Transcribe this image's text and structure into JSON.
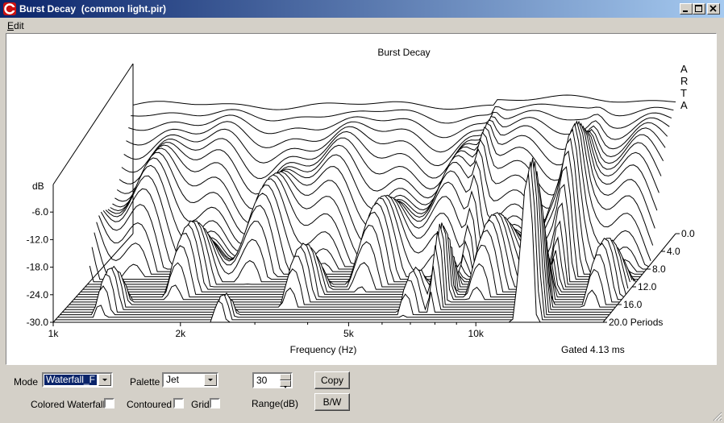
{
  "window": {
    "title": "Burst Decay  (common light.pir)",
    "controls": [
      "minimize-icon",
      "maximize-icon",
      "close-icon"
    ]
  },
  "menu": {
    "edit_accel": "E",
    "edit_rest": "dit"
  },
  "plot": {
    "title": "Burst Decay",
    "ylabel": "dB",
    "xlabel": "Frequency (Hz)",
    "gated_label": "Gated 4.13 ms",
    "arta_letters": [
      "A",
      "R",
      "T",
      "A"
    ],
    "y_ticks": [
      "-6.0",
      "-12.0",
      "-18.0",
      "-24.0",
      "-30.0"
    ],
    "x_ticks": [
      "1k",
      "2k",
      "5k",
      "10k"
    ],
    "z_ticks": [
      "0.0",
      "4.0",
      "8.0",
      "12.0",
      "16.0",
      "20.0 Periods"
    ]
  },
  "chart_data": {
    "type": "waterfall",
    "title": "Burst Decay",
    "xlabel": "Frequency (Hz)",
    "ylabel": "dB",
    "zlabel": "Periods",
    "x_scale": "log",
    "xlim": [
      1000,
      20000
    ],
    "ylim": [
      -30,
      0
    ],
    "zlim": [
      0,
      20
    ],
    "grid": false,
    "annotation": "Gated 4.13 ms"
  },
  "controls": {
    "mode_label": "Mode",
    "mode_value": "Waterfall_F",
    "palette_label": "Palette",
    "palette_value": "Jet",
    "range_value": "30",
    "range_label": "Range(dB)",
    "copy_label": "Copy",
    "bw_label": "B/W",
    "colored_waterfall_label": "Colored Waterfall",
    "contoured_label": "Contoured",
    "grid_label": "Grid"
  }
}
